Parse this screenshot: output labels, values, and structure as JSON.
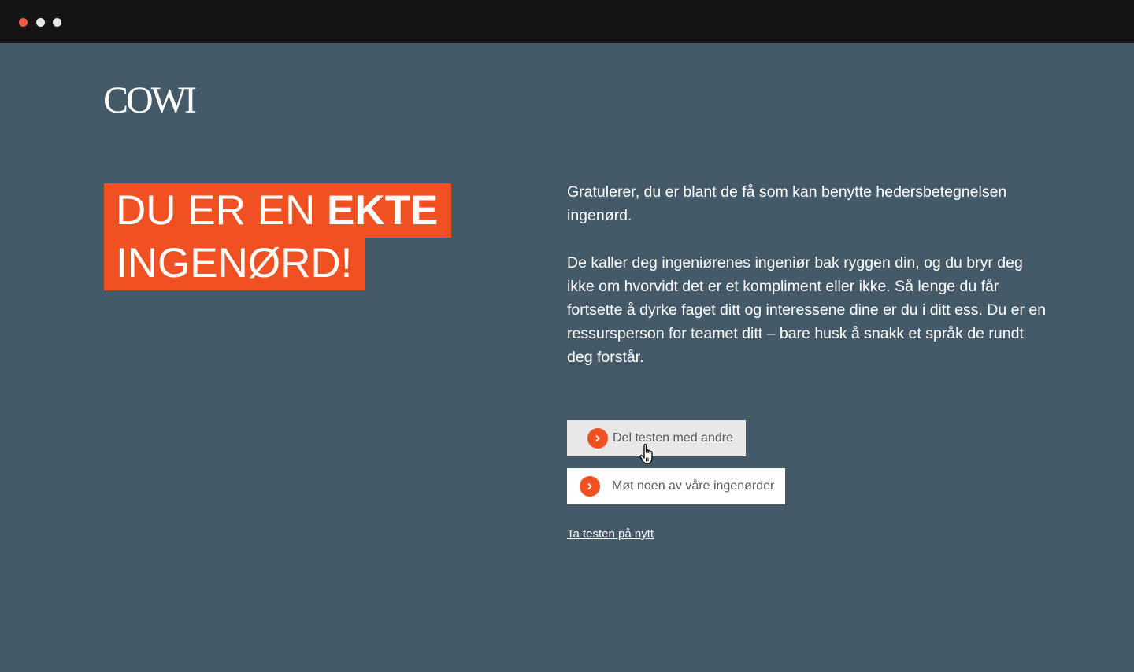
{
  "window": {
    "dots": [
      "#ef5a47",
      "#e6e6e6",
      "#e6e6e6"
    ]
  },
  "brand": {
    "logo_text": "COWI"
  },
  "headline": {
    "line1_light": "DU ER EN ",
    "line1_bold": "EKTE",
    "line2": "INGENØRD!",
    "accent_color": "#f15122"
  },
  "result": {
    "paragraph1": "Gratulerer, du er blant de få som kan benytte hedersbetegnelsen ingenørd.",
    "paragraph2": "De kaller deg ingeniørenes ingeniør bak ryggen din, og du bryr deg ikke om hvorvidt det er et kompliment eller ikke. Så lenge du får fortsette å dyrke faget ditt og interessene dine er du i ditt ess. Du er en ressursperson for teamet ditt – bare husk å snakk et språk de rundt deg forstår."
  },
  "actions": {
    "share_label": "Del testen med andre",
    "share_icon": "chevron-right-icon",
    "share_bg": "#e8e8e8",
    "meet_label": "Møt noen av våre ingenørder",
    "meet_icon": "chevron-right-icon",
    "meet_bg": "#ffffff",
    "retake_label": "Ta testen på nytt"
  }
}
